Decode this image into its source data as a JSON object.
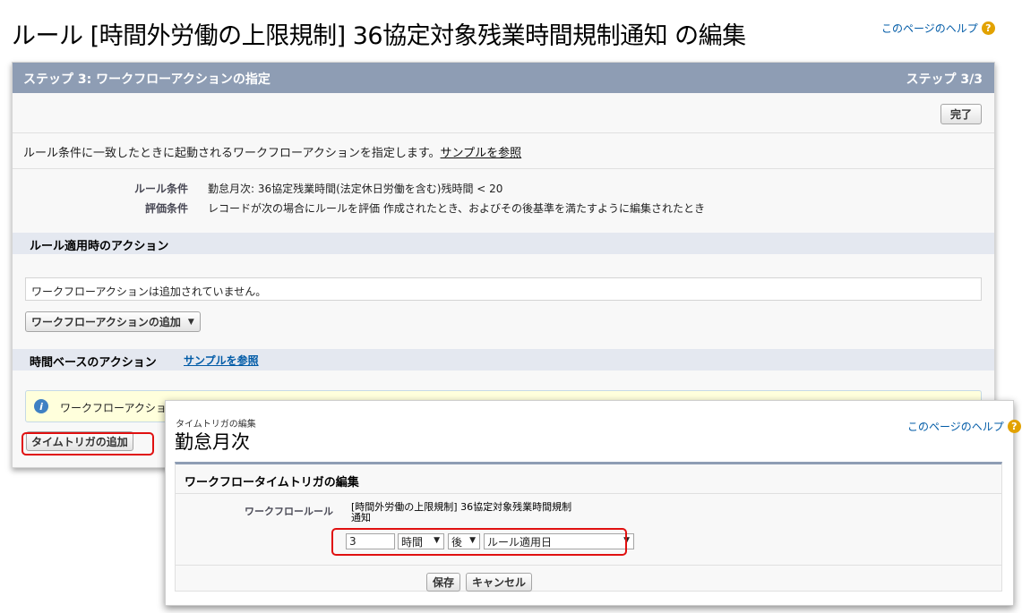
{
  "page": {
    "title": "ルール [時間外労働の上限規制] 36協定対象残業時間規制通知 の編集",
    "help_link": "このページのヘルプ"
  },
  "step": {
    "title": "ステップ 3: ワークフローアクションの指定",
    "counter": "ステップ 3/3",
    "done_button": "完了"
  },
  "description": {
    "text": "ルール条件に一致したときに起動されるワークフローアクションを指定します。",
    "sample_link": "サンプルを参照"
  },
  "rule": {
    "condition_label": "ルール条件",
    "condition_value": "勤怠月次: 36協定残業時間(法定休日労働を含む)残時間 < 20",
    "eval_label": "評価条件",
    "eval_value": "レコードが次の場合にルールを評価 作成されたとき、およびその後基準を満たすように編集されたとき"
  },
  "rule_actions": {
    "heading": "ルール適用時のアクション",
    "empty_message": "ワークフローアクションは追加されていません。",
    "add_button": "ワークフローアクションの追加"
  },
  "time_actions": {
    "heading": "時間ベースのアクション",
    "sample_link": "サンプルを参照",
    "info_text": "ワークフローアクション",
    "add_trigger_button": "タイムトリガの追加"
  },
  "trigger_dialog": {
    "small_title": "タイムトリガの編集",
    "object_name": "勤怠月次",
    "help_link": "このページのヘルプ",
    "panel_heading": "ワークフロータイムトリガの編集",
    "rule_label": "ワークフロールール",
    "rule_value_line1": "[時間外労働の上限規制] 36協定対象残業時間規制",
    "rule_value_line2": "通知",
    "amount": "3",
    "unit": "時間",
    "direction": "後",
    "field": "ルール適用日",
    "save_button": "保存",
    "cancel_button": "キャンセル"
  },
  "colors": {
    "step_bar": "#8e9db4",
    "section_head": "#e4e8f0",
    "highlight": "#e01010",
    "link": "#015ba7",
    "help_icon": "#e2a200"
  }
}
